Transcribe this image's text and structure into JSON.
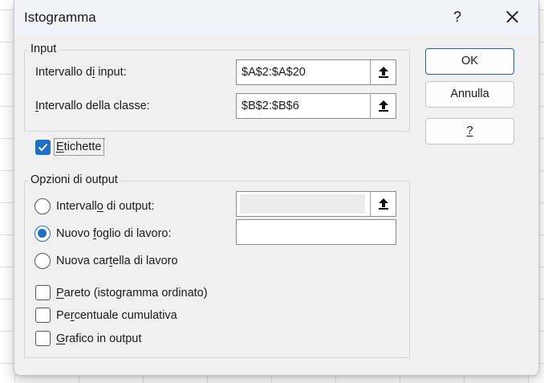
{
  "window": {
    "title": "Istogramma",
    "help_glyph": "?"
  },
  "input_group": {
    "legend": "Input",
    "input_range": {
      "label": "Intervallo di input:",
      "underline": "i",
      "value": "$A$2:$A$20"
    },
    "bin_range": {
      "label": "Intervallo della classe:",
      "underline": "I",
      "value": "$B$2:$B$6"
    }
  },
  "labels_checkbox": {
    "label": "Etichette",
    "underline": "E",
    "checked": true
  },
  "output_group": {
    "legend": "Opzioni di output",
    "output_range": {
      "label": "Intervallo di output:",
      "underline": "o",
      "selected": false,
      "value": ""
    },
    "new_sheet": {
      "label": "Nuovo foglio di lavoro:",
      "underline": "f",
      "selected": true,
      "value": ""
    },
    "new_workbook": {
      "label": "Nuova cartella di lavoro",
      "underline": "t",
      "selected": false
    },
    "pareto": {
      "label": "Pareto (istogramma ordinato)",
      "underline": "P",
      "checked": false
    },
    "cumulative": {
      "label": "Percentuale cumulativa",
      "underline": "r",
      "checked": false
    },
    "chart": {
      "label": "Grafico in output",
      "underline": "G",
      "checked": false
    }
  },
  "buttons": {
    "ok": "OK",
    "cancel": "Annulla",
    "help": "?"
  },
  "colors": {
    "accent": "#1f6fc4",
    "dialog_bg": "#f0f0f0",
    "titlebar_bg": "#f0f4f8"
  },
  "icons": {
    "ref_button": "collapse-dialog-arrow-icon",
    "close": "close-icon"
  }
}
